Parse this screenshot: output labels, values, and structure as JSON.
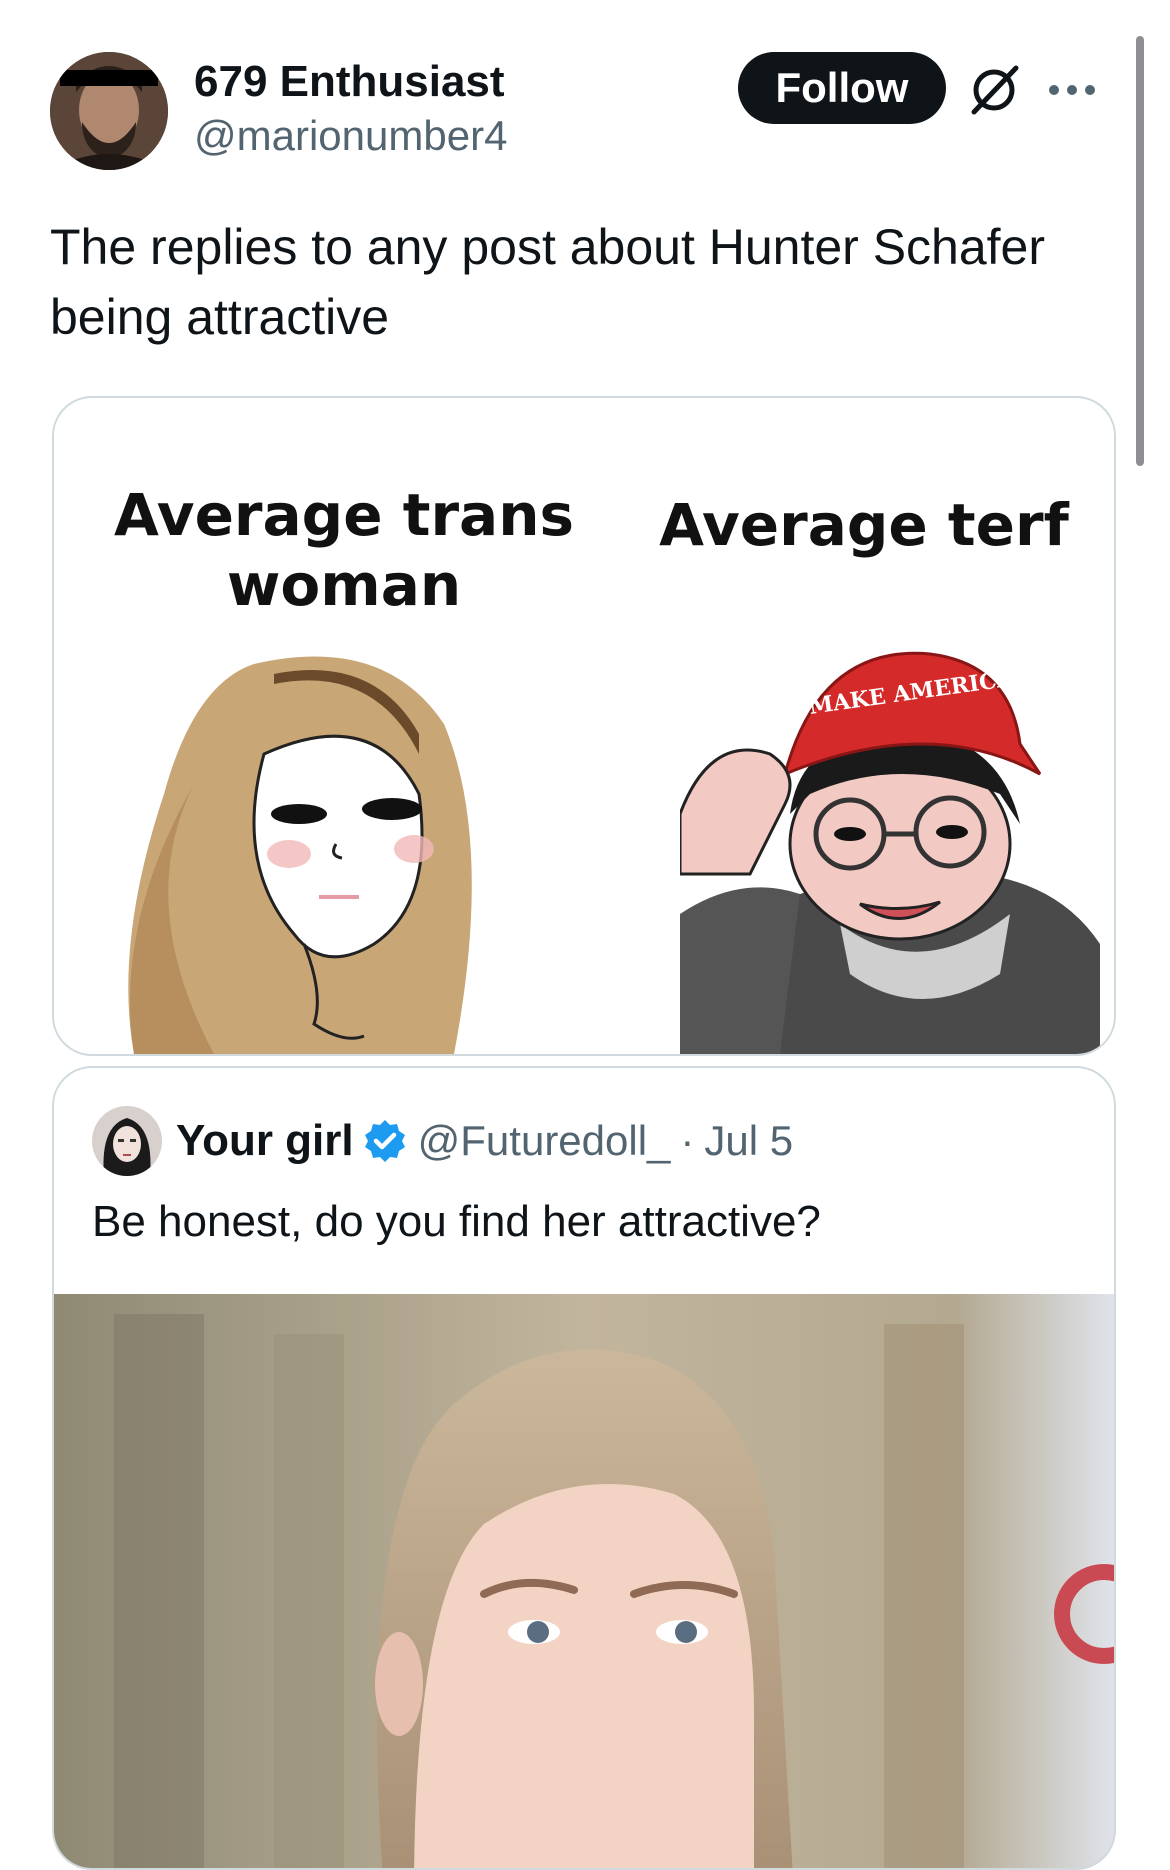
{
  "post": {
    "author": {
      "display_name": "679 Enthusiast",
      "handle": "@marionumber4",
      "avatar_icon": "user-avatar-censored-eyes"
    },
    "actions": {
      "follow_label": "Follow",
      "grok_icon": "grok-icon",
      "more_icon": "more-horizontal-icon"
    },
    "text": "The replies to any post about Hunter Schafer being attractive",
    "media": {
      "left_label": "Average trans woman",
      "right_label": "Average terf",
      "hat_text": "MAKE AMERICA GREAT AGAIN"
    }
  },
  "quoted_post": {
    "display_name": "Your girl",
    "verified_icon": "verified-badge-icon",
    "handle": "@Futuredoll_",
    "separator": "·",
    "date": "Jul 5",
    "text": "Be honest, do you find her attractive?"
  },
  "colors": {
    "text_primary": "#0f1419",
    "text_secondary": "#536471",
    "border": "#cfd9de",
    "verified_blue": "#1d9bf0",
    "follow_bg": "#0f1419",
    "hat_red": "#d42a2a"
  }
}
